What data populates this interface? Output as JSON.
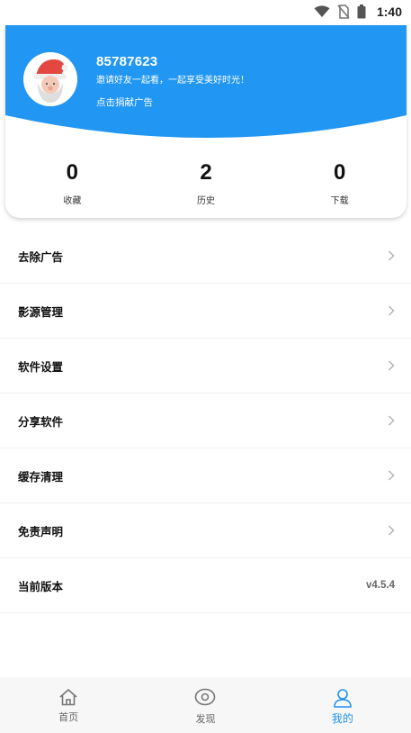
{
  "status_bar": {
    "time": "1:40",
    "icons": [
      "wifi-icon",
      "no-sim-icon",
      "battery-icon"
    ]
  },
  "profile": {
    "user_id": "85787623",
    "invite_text": "邀请好友一起看，一起享受美好时光！",
    "donate_link": "点击捐献广告",
    "avatar_icon": "santa-avatar-icon"
  },
  "stats": [
    {
      "value": "0",
      "label": "收藏"
    },
    {
      "value": "2",
      "label": "历史"
    },
    {
      "value": "0",
      "label": "下载"
    }
  ],
  "menu": {
    "items": [
      {
        "label": "去除广告",
        "icon": "chevron-right-icon"
      },
      {
        "label": "影源管理",
        "icon": "chevron-right-icon"
      },
      {
        "label": "软件设置",
        "icon": "chevron-right-icon"
      },
      {
        "label": "分享软件",
        "icon": "chevron-right-icon"
      },
      {
        "label": "缓存清理",
        "icon": "chevron-right-icon"
      },
      {
        "label": "免责声明",
        "icon": "chevron-right-icon"
      }
    ],
    "version": {
      "label": "当前版本",
      "value": "v4.5.4"
    }
  },
  "bottom_nav": {
    "items": [
      {
        "label": "首页",
        "icon": "home-icon"
      },
      {
        "label": "发现",
        "icon": "eye-icon"
      },
      {
        "label": "我的",
        "icon": "user-icon",
        "active": true
      }
    ]
  },
  "colors": {
    "accent": "#1f93ee",
    "header_blue": "#2196f3",
    "nav_background": "#f7f7f7"
  }
}
